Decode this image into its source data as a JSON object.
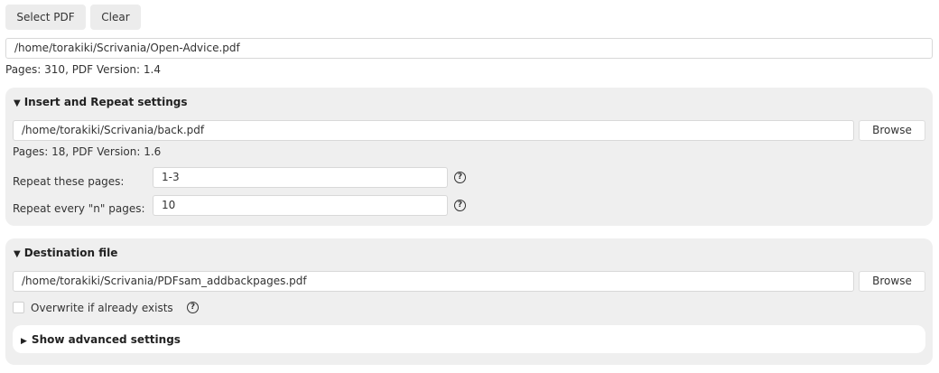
{
  "toolbar": {
    "select_pdf_label": "Select PDF",
    "clear_label": "Clear"
  },
  "source": {
    "path": "/home/torakiki/Scrivania/Open-Advice.pdf",
    "info": "Pages: 310, PDF Version: 1.4"
  },
  "insert_repeat": {
    "title": "Insert and Repeat settings",
    "toggle_glyph": "▼",
    "file_path": "/home/torakiki/Scrivania/back.pdf",
    "browse_label": "Browse",
    "info": "Pages: 18, PDF Version: 1.6",
    "repeat_pages_label": "Repeat these pages:",
    "repeat_pages_value": "1-3",
    "repeat_every_label": "Repeat every \"n\" pages:",
    "repeat_every_value": "10",
    "help_glyph": "?"
  },
  "destination": {
    "title": "Destination file",
    "toggle_glyph": "▼",
    "file_path": "/home/torakiki/Scrivania/PDFsam_addbackpages.pdf",
    "browse_label": "Browse",
    "overwrite_label": "Overwrite if already exists",
    "overwrite_checked": false,
    "help_glyph": "?",
    "advanced_label": "Show advanced settings",
    "advanced_glyph": "▶"
  }
}
